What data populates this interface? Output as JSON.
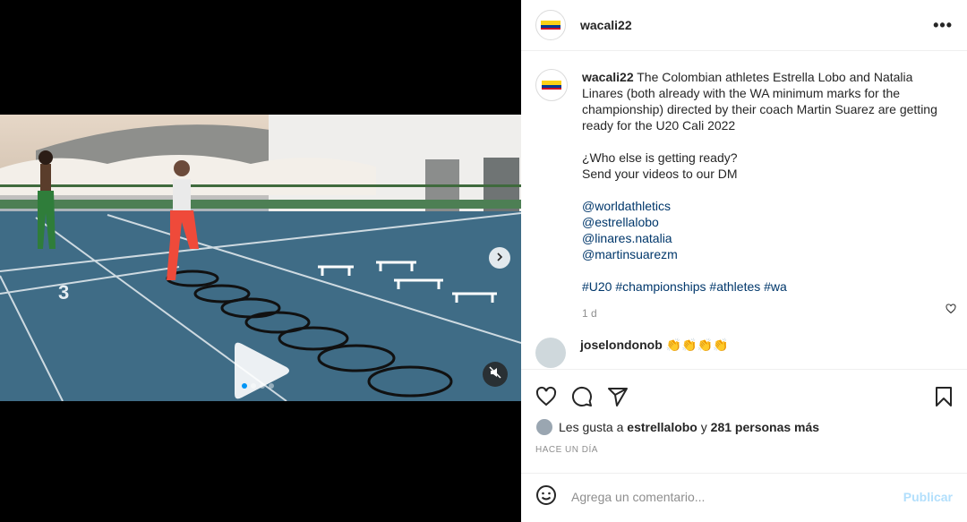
{
  "post": {
    "username": "wacali22",
    "more_icon": "more-horizontal-icon"
  },
  "caption": {
    "username": "wacali22",
    "text": "The Colombian athletes Estrella Lobo and Natalia Linares (both already with the WA minimum marks for the championship) directed by their coach Martin Suarez are getting ready for the U20 Cali 2022",
    "line2": "¿Who else is getting ready?",
    "line3": "Send your videos to our DM",
    "mentions": [
      "@worldathletics",
      "@estrellalobo",
      "@linares.natalia",
      "@martinsuarezm"
    ],
    "hashtags": "#U20 #championships #athletes #wa",
    "time": "1 d"
  },
  "comment": {
    "username": "joselondonob",
    "emoji": "👏👏👏👏"
  },
  "likes": {
    "prefix": "Les gusta a",
    "user": "estrellalobo",
    "conj": "y",
    "others": "281 personas más"
  },
  "timestamp": "HACE UN DÍA",
  "add_comment": {
    "placeholder": "Agrega un comentario...",
    "publish": "Publicar"
  },
  "carousel": {
    "slides": 4,
    "active": 1
  },
  "colors": {
    "link": "#00376b",
    "accent": "#0095f6",
    "publish_disabled": "#b2dffc"
  }
}
